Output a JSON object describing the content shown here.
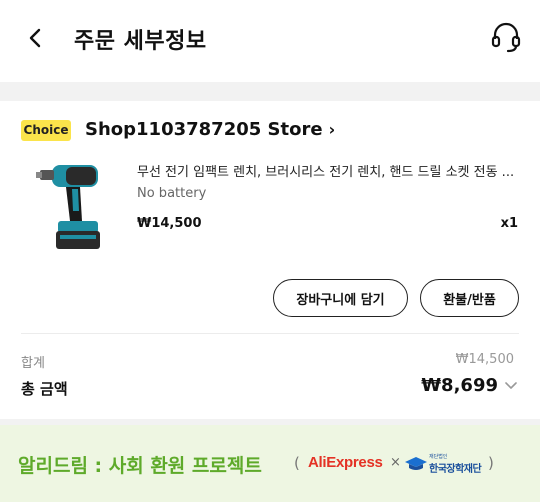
{
  "header": {
    "title": "주문 세부정보"
  },
  "store": {
    "badge": "Choice",
    "name": "Shop1103787205 Store",
    "chevron": "›"
  },
  "product": {
    "title": "무선 전기 임팩트 렌치, 브러시리스 전기 렌치, 핸드 드릴 소켓 전동 ...",
    "variant": "No battery",
    "price": "₩14,500",
    "quantity": "x1"
  },
  "actions": {
    "add_to_cart": "장바구니에 담기",
    "refund_return": "환불/반품"
  },
  "summary": {
    "subtotal_label": "합계",
    "subtotal_value": "₩14,500",
    "total_label": "총 금액",
    "total_value": "₩8,699"
  },
  "banner": {
    "title": "알리드림 : 사회 환원 프로젝트",
    "paren_open": "(",
    "partner1": "AliExpress",
    "times": "×",
    "partner2_small": "재단법인",
    "partner2": "한국장학재단",
    "paren_close": ")"
  },
  "colors": {
    "choice_yellow": "#fbe44b",
    "banner_green": "#5eaa2a",
    "banner_bg": "#eef6e2",
    "aliexpress_red": "#e43225",
    "kosaf_blue": "#1a4f9c"
  },
  "icons": {
    "back": "back-arrow-icon",
    "support": "headset-icon",
    "store_chevron": "chevron-right-icon",
    "total_expand": "chevron-down-icon"
  }
}
